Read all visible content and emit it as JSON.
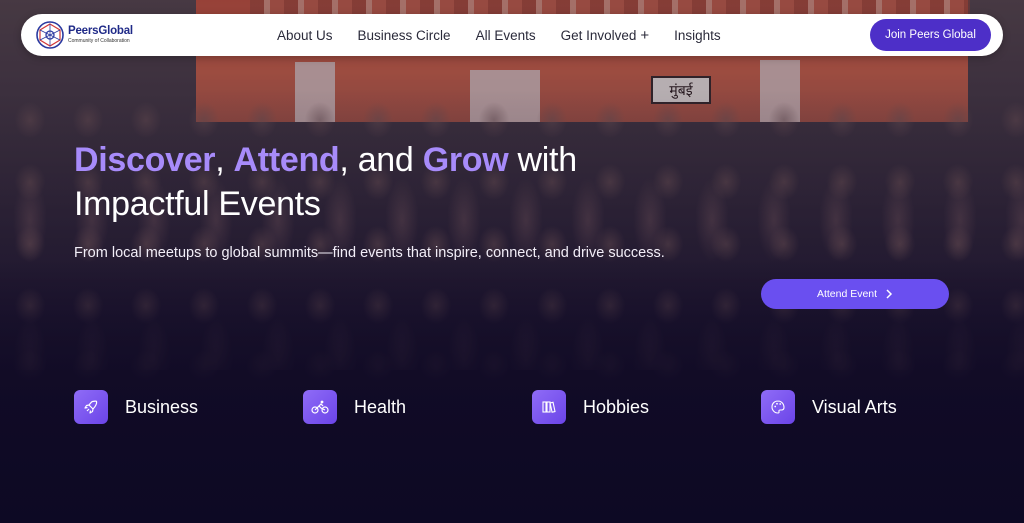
{
  "brand": {
    "name": "PeersGlobal",
    "tagline": "Community of Collaboration"
  },
  "nav": {
    "links": [
      "About Us",
      "Business Circle",
      "All Events",
      "Get Involved",
      "Insights"
    ],
    "get_involved_suffix": "+",
    "cta_label": "Join Peers Global"
  },
  "hero": {
    "headline_parts": [
      "Discover",
      ", ",
      "Attend",
      ", and ",
      "Grow",
      " with"
    ],
    "headline_line2": "Impactful Events",
    "subtext": "From local meetups to global summits—find events that inspire, connect, and drive success.",
    "cta_label": "Attend Event",
    "background_sign_text": "मुंबई"
  },
  "categories": [
    {
      "label": "Business",
      "icon": "rocket-icon"
    },
    {
      "label": "Health",
      "icon": "cycling-icon"
    },
    {
      "label": "Hobbies",
      "icon": "books-icon"
    },
    {
      "label": "Visual Arts",
      "icon": "palette-icon"
    }
  ],
  "colors": {
    "accent": "#a78bfa",
    "button_primary": "#4d2fc8",
    "cta": "#6a4ff0",
    "background": "#0b0820"
  }
}
